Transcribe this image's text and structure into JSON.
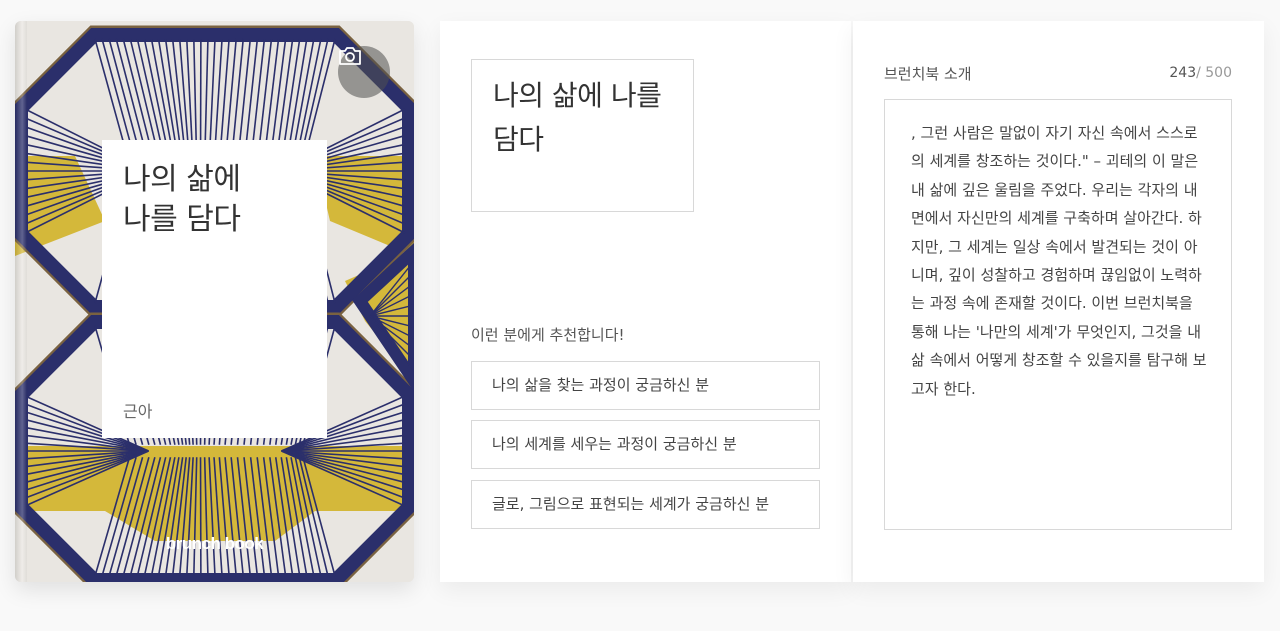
{
  "cover": {
    "title": "나의 삶에\n나를 담다",
    "author": "근아",
    "brand": "brunch book",
    "colors": {
      "navy": "#2b2f6b",
      "gold": "#d4b83a",
      "bronze": "#7a6240",
      "background": "#e9e6e1"
    }
  },
  "middle": {
    "title": "나의 삶에 나를 담다",
    "recommend_label": "이런 분에게 추천합니다!",
    "recommendations": [
      "나의 삶을 찾는 과정이 궁금하신 분",
      "나의 세계를 세우는 과정이 궁금하신 분",
      "글로, 그림으로 표현되는 세계가 궁금하신 분"
    ]
  },
  "intro": {
    "label": "브런치북 소개",
    "count": "243",
    "max": "/ 500",
    "text": ", 그런 사람은 말없이 자기 자신 속에서 스스로의 세계를 창조하는 것이다.\" – 괴테의 이 말은 내 삶에 깊은 울림을 주었다. 우리는 각자의 내면에서 자신만의 세계를 구축하며 살아간다. 하지만, 그 세계는 일상 속에서 발견되는 것이 아니며, 깊이 성찰하고 경험하며 끊임없이 노력하는 과정 속에 존재할 것이다. 이번 브런치북을 통해 나는 '나만의 세계'가 무엇인지, 그것을 내 삶 속에서 어떻게 창조할 수 있을지를 탐구해 보고자 한다."
  }
}
